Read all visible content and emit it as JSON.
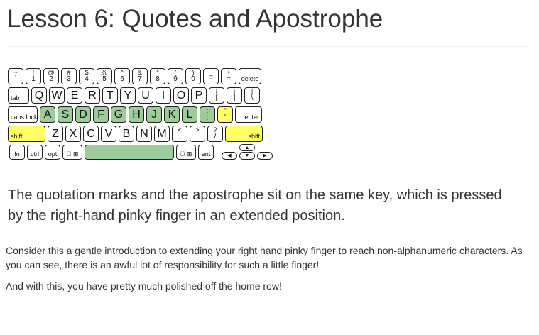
{
  "page": {
    "title": "Lesson 6: Quotes and Apostrophe",
    "lead": "The quotation marks and the apostrophe sit on the same key, which is pressed by the right-hand pinky finger in an extended position.",
    "paragraphs": [
      "Consider this a gentle introduction to extending your right hand pinky finger to reach non-alphanumeric characters. As you can see, there is an awful lot of responsibility for such a little finger!",
      "And with this, you have pretty much polished off the home row!"
    ]
  },
  "colors": {
    "home_row": "#9ccc9a",
    "target": "#ffff66",
    "text": "#333333"
  },
  "keyboard": {
    "rows": [
      {
        "keys": [
          {
            "shift": "~",
            "base": "`"
          },
          {
            "shift": "!",
            "base": "1"
          },
          {
            "shift": "@",
            "base": "2"
          },
          {
            "shift": "#",
            "base": "3"
          },
          {
            "shift": "$",
            "base": "4"
          },
          {
            "shift": "%",
            "base": "5"
          },
          {
            "shift": "^",
            "base": "6"
          },
          {
            "shift": "&",
            "base": "7"
          },
          {
            "shift": "*",
            "base": "8"
          },
          {
            "shift": "(",
            "base": "9"
          },
          {
            "shift": ")",
            "base": "0"
          },
          {
            "shift": "_",
            "base": "-"
          },
          {
            "shift": "+",
            "base": "="
          },
          {
            "label": "delete",
            "align": "center"
          }
        ]
      },
      {
        "keys": [
          {
            "label": "tab",
            "align": "left"
          },
          {
            "main": "Q"
          },
          {
            "main": "W"
          },
          {
            "main": "E"
          },
          {
            "main": "R"
          },
          {
            "main": "T"
          },
          {
            "main": "Y"
          },
          {
            "main": "U"
          },
          {
            "main": "I"
          },
          {
            "main": "O"
          },
          {
            "main": "P"
          },
          {
            "shift": "{",
            "base": "["
          },
          {
            "shift": "}",
            "base": "]"
          },
          {
            "shift": "|",
            "base": "\\"
          }
        ]
      },
      {
        "keys": [
          {
            "label": "caps lock",
            "align": "left"
          },
          {
            "main": "A",
            "state": "home"
          },
          {
            "main": "S",
            "state": "home"
          },
          {
            "main": "D",
            "state": "home"
          },
          {
            "main": "F",
            "state": "home"
          },
          {
            "main": "G",
            "state": "home"
          },
          {
            "main": "H",
            "state": "home"
          },
          {
            "main": "J",
            "state": "home"
          },
          {
            "main": "K",
            "state": "home"
          },
          {
            "main": "L",
            "state": "home"
          },
          {
            "shift": ":",
            "base": ";",
            "state": "home"
          },
          {
            "shift": "\"",
            "base": "'",
            "state": "target"
          },
          {
            "label": "enter",
            "align": "right"
          }
        ]
      },
      {
        "keys": [
          {
            "label": "shift",
            "align": "left",
            "state": "target"
          },
          {
            "main": "Z"
          },
          {
            "main": "X"
          },
          {
            "main": "C"
          },
          {
            "main": "V"
          },
          {
            "main": "B"
          },
          {
            "main": "N"
          },
          {
            "main": "M"
          },
          {
            "shift": "<",
            "base": ","
          },
          {
            "shift": ">",
            "base": "."
          },
          {
            "shift": "?",
            "base": "/"
          },
          {
            "label": "shift",
            "align": "right",
            "state": "target"
          }
        ]
      },
      {
        "keys": [
          {
            "label": "fn",
            "align": "center"
          },
          {
            "label": "ctrl",
            "align": "center"
          },
          {
            "label": "opt",
            "align": "center"
          },
          {
            "label": " ⊞",
            "align": "center"
          },
          {
            "label": "",
            "state": "home"
          },
          {
            "label": " ⊞",
            "align": "center"
          },
          {
            "label": "ent",
            "align": "center"
          }
        ]
      }
    ],
    "arrows": {
      "up": "▲",
      "left": "◀",
      "down": "▼",
      "right": "▶"
    }
  }
}
